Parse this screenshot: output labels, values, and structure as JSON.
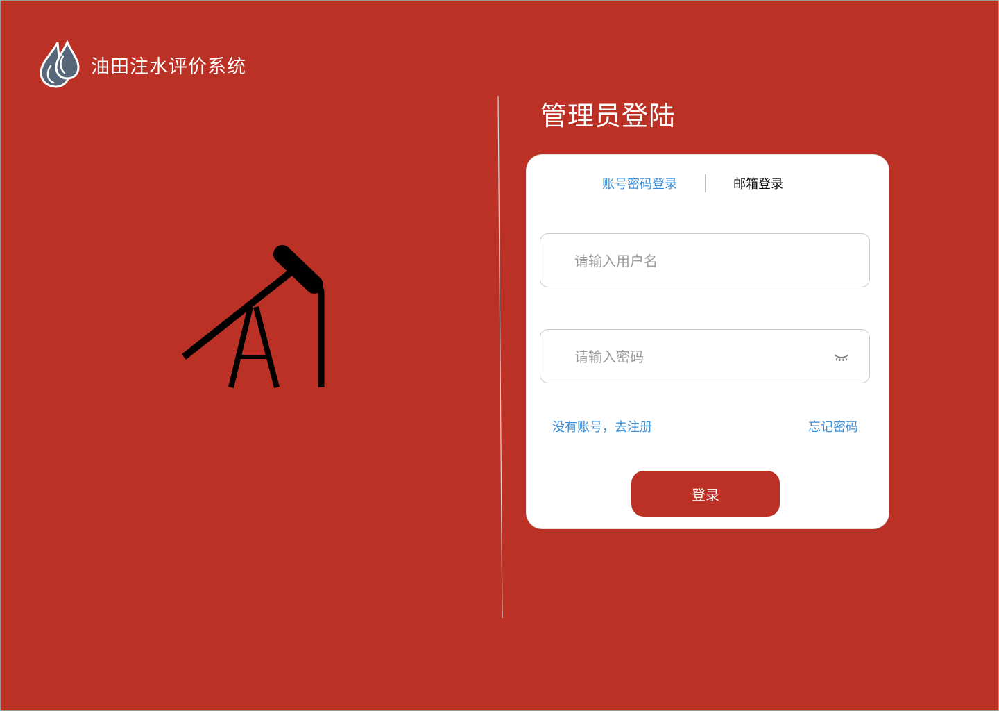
{
  "app": {
    "title": "油田注水评价系统",
    "logo_icon": "water-drops-icon"
  },
  "hero": {
    "illustration_icon": "oil-pump-jack-icon"
  },
  "login": {
    "title": "管理员登陆",
    "tabs": [
      {
        "label": "账号密码登录",
        "active": true
      },
      {
        "label": "邮箱登录",
        "active": false
      }
    ],
    "username": {
      "value": "",
      "placeholder": "请输入用户名"
    },
    "password": {
      "value": "",
      "placeholder": "请输入密码",
      "toggle_icon": "eye-closed-icon"
    },
    "register_link": "没有账号，去注册",
    "forgot_link": "忘记密码",
    "submit_label": "登录"
  },
  "colors": {
    "background": "#bc3125",
    "primary": "#bc3125",
    "link": "#3b8fd9",
    "card": "#ffffff"
  }
}
